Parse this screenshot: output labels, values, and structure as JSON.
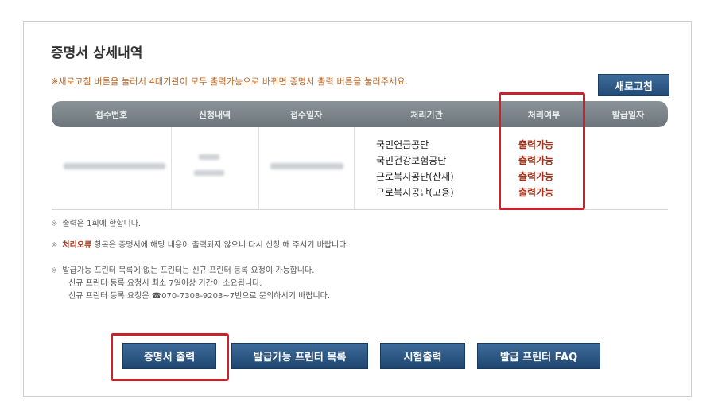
{
  "page": {
    "title": "증명서 상세내역",
    "notice": "※새로고침 버튼을 눌러서 4대기관이 모두 출력가능으로 바뀌면 증명서 출력 버튼을 눌러주세요.",
    "refresh_button": "새로고침"
  },
  "table": {
    "headers": [
      "접수번호",
      "신청내역",
      "접수일자",
      "처리기관",
      "처리여부",
      "발급일자"
    ],
    "agencies": [
      "국민연금공단",
      "국민건강보험공단",
      "근로복지공단(산재)",
      "근로복지공단(고용)"
    ],
    "statuses": [
      "출력가능",
      "출력가능",
      "출력가능",
      "출력가능"
    ]
  },
  "notes": {
    "mark": "※",
    "note1": "출력은 1회에 한합니다.",
    "note2_em": "처리오류",
    "note2_rest": " 항목은 증명서에 해당 내용이 출력되지 않으니 다시 신청 해 주시기 바랍니다.",
    "note3_line1": "발급가능 프린터 목록에 없는 프린터는 신규 프린터 등록 요청이 가능합니다.",
    "note3_line2": "신규 프린터 등록 요청시 최소 7일이상 기간이 소요됩니다.",
    "note3_line3": "신규 프린터 등록 요청은 ☎070-7308-9203~7번으로 문의하시기 바랍니다."
  },
  "buttons": {
    "print": "증명서 출력",
    "printer_list": "발급가능 프린터 목록",
    "test_print": "시험출력",
    "printer_faq": "발급 프린터 FAQ"
  },
  "colors": {
    "highlight_box": "#c8232c",
    "button_blue": "#2a5583",
    "status_text": "#a5341c"
  }
}
